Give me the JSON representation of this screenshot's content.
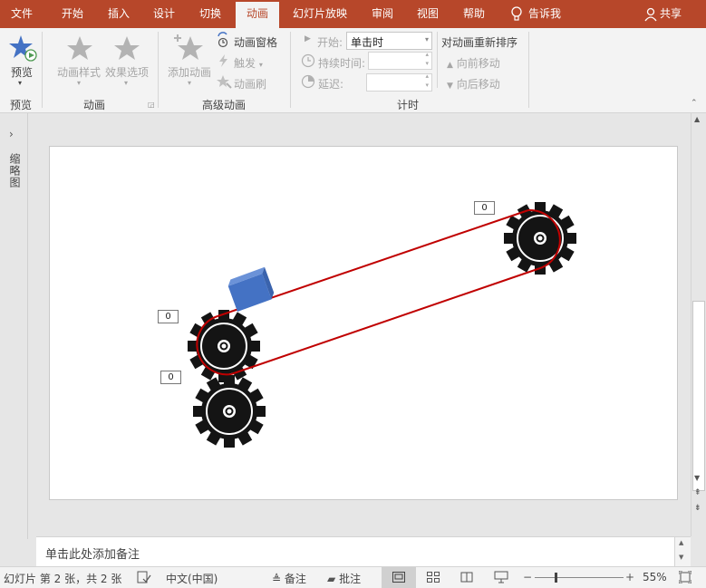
{
  "tabs": [
    {
      "label": "文件"
    },
    {
      "label": "开始"
    },
    {
      "label": "插入"
    },
    {
      "label": "设计"
    },
    {
      "label": "切换"
    },
    {
      "label": "动画"
    },
    {
      "label": "幻灯片放映"
    },
    {
      "label": "审阅"
    },
    {
      "label": "视图"
    },
    {
      "label": "帮助"
    }
  ],
  "tell_me": "告诉我",
  "share": "共享",
  "ribbon": {
    "preview": {
      "label": "预览",
      "group": "预览"
    },
    "animation": {
      "style_label": "动画样式",
      "effect_label": "效果选项",
      "group": "动画"
    },
    "advanced": {
      "add_label": "添加动画",
      "pane_label": "动画窗格",
      "trigger_label": "触发",
      "painter_label": "动画刷",
      "group": "高级动画"
    },
    "timing": {
      "start_label": "开始:",
      "start_value": "单击时",
      "duration_label": "持续时间:",
      "delay_label": "延迟:",
      "group": "计时"
    },
    "reorder": {
      "title": "对动画重新排序",
      "forward_label": "向前移动",
      "backward_label": "向后移动"
    }
  },
  "left_pane": {
    "label": "缩略图"
  },
  "slide": {
    "badges": [
      "0",
      "0",
      "0"
    ]
  },
  "notes_placeholder": "单击此处添加备注",
  "status": {
    "slide_info": "幻灯片 第 2 张，共 2 张",
    "language": "中文(中国)",
    "notes_label": "备注",
    "comments_label": "批注",
    "zoom": "55%"
  },
  "colors": {
    "accent": "#b7472a",
    "belt": "#c00000",
    "box": "#4472c4"
  }
}
